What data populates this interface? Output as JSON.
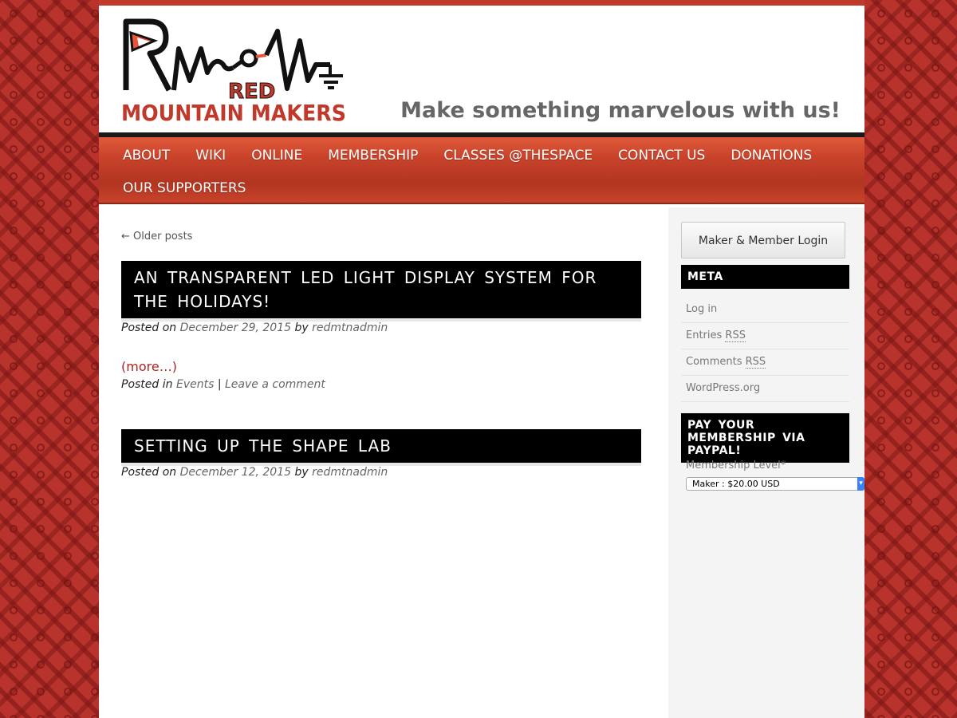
{
  "header": {
    "logo_text_red": "RED",
    "logo_text_name": "MOUNTAIN MAKERS",
    "tagline": "Make something marvelous with us!"
  },
  "nav": {
    "items": [
      "ABOUT",
      "WIKI",
      "ONLINE",
      "MEMBERSHIP",
      "CLASSES @THESPACE",
      "CONTACT US",
      "DONATIONS",
      "OUR SUPPORTERS"
    ]
  },
  "main": {
    "older_posts": "← Older posts",
    "posts": [
      {
        "title": "AN TRANSPARENT LED LIGHT DISPLAY SYSTEM FOR THE HOLIDAYS!",
        "posted_on_label": "Posted on",
        "date": "December 29, 2015",
        "by_label": "by",
        "author": "redmtnadmin",
        "more": "(more…)",
        "posted_in_label": "Posted in",
        "category": "Events",
        "separator": "|",
        "comment_link": "Leave a comment"
      },
      {
        "title": "SETTING UP THE SHAPE LAB",
        "posted_on_label": "Posted on",
        "date": "December 12, 2015",
        "by_label": "by",
        "author": "redmtnadmin"
      }
    ]
  },
  "sidebar": {
    "login_button": "Maker & Member Login",
    "meta_heading": "META",
    "meta_links": {
      "login": "Log in",
      "entries_prefix": "Entries",
      "comments_prefix": "Comments",
      "rss": "RSS",
      "wordpress": "WordPress.org"
    },
    "paypal_heading": "PAY YOUR MEMBERSHIP VIA PAYPAL!",
    "membership_label": "Membership Level*",
    "membership_selected": "Maker : $20.00 USD"
  },
  "colors": {
    "accent_red": "#c0392b",
    "nav_gradient_mid": "#c9432b",
    "link_red": "#b22222",
    "title_bg": "#000000"
  }
}
